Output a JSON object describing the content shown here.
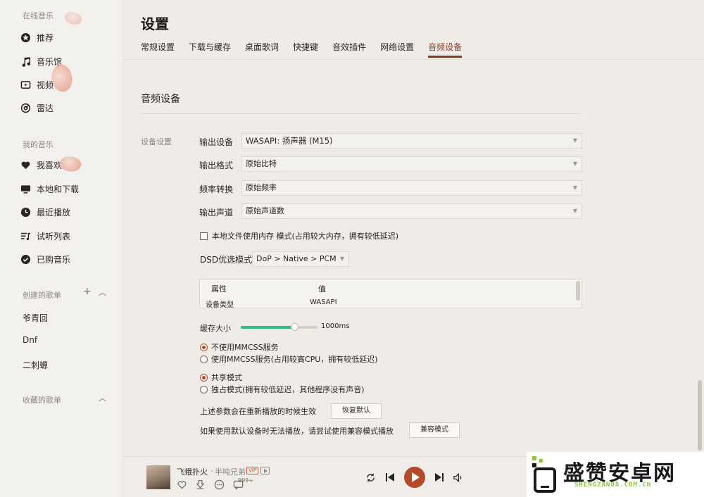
{
  "sidebar": {
    "online_section": "在线音乐",
    "online_items": [
      {
        "label": "推荐",
        "icon": "star-icon"
      },
      {
        "label": "音乐馆",
        "icon": "music-note-icon"
      },
      {
        "label": "视频",
        "icon": "video-icon"
      },
      {
        "label": "雷达",
        "icon": "radar-icon"
      }
    ],
    "my_section": "我的音乐",
    "my_items": [
      {
        "label": "我喜欢",
        "icon": "heart-icon"
      },
      {
        "label": "本地和下载",
        "icon": "monitor-icon"
      },
      {
        "label": "最近播放",
        "icon": "clock-icon"
      },
      {
        "label": "试听列表",
        "icon": "playlist-icon"
      },
      {
        "label": "已购音乐",
        "icon": "check-circle-icon"
      }
    ],
    "created_section": "创建的歌单",
    "playlists": [
      "爷青回",
      "Dnf",
      "二刺螈"
    ],
    "collected_section": "收藏的歌单"
  },
  "header": {
    "title": "设置",
    "tabs": [
      "常规设置",
      "下载与缓存",
      "桌面歌词",
      "快捷键",
      "音效插件",
      "网络设置",
      "音频设备"
    ],
    "active_tab": "音频设备"
  },
  "audio": {
    "section_title": "音频设备",
    "group_label": "设备设置",
    "output_device_label": "输出设备",
    "output_device_value": "WASAPI: 扬声器 (M15)",
    "output_format_label": "输出格式",
    "output_format_value": "原始比特",
    "sample_rate_label": "频率转换",
    "sample_rate_value": "原始频率",
    "channels_label": "输出声道",
    "channels_value": "原始声道数",
    "memory_checkbox_label": "本地文件使用内存 模式(占用较大内存，拥有较低延迟)",
    "memory_checkbox_checked": false,
    "dsd_label": "DSD优选模式",
    "dsd_value": "DoP > Native > PCM",
    "table_headers": [
      "属性",
      "值"
    ],
    "table_rows": [
      [
        "设备类型",
        "WASAPI"
      ]
    ],
    "buffer_label": "缓存大小",
    "buffer_value": "1000ms",
    "buffer_fraction": 0.7,
    "mmcss_options": [
      "不使用MMCSS服务",
      "使用MMCSS服务(占用较高CPU，拥有较低延迟)"
    ],
    "mmcss_selected": 0,
    "mode_options": [
      "共享模式",
      "独占模式(拥有较低延迟，其他程序没有声音)"
    ],
    "mode_selected": 0,
    "restart_note": "上述参数会在重新播放的时候生效",
    "restore_button": "恢复默认",
    "compat_note": "如果使用默认设备时无法播放，请尝试使用兼容模式播放",
    "compat_button": "兼容模式"
  },
  "player": {
    "song_title": "飞蛾扑火",
    "separator": "-",
    "artist": "半吨兄弟",
    "vip_badge": "VIP",
    "comment_count": "999+"
  },
  "watermark": {
    "title": "盛赞安卓网",
    "url": "SHENGZAN08.COM.CN"
  },
  "colors": {
    "accent": "#8a3a24",
    "play_button": "#b34a2c",
    "slider": "#2fb98a"
  }
}
